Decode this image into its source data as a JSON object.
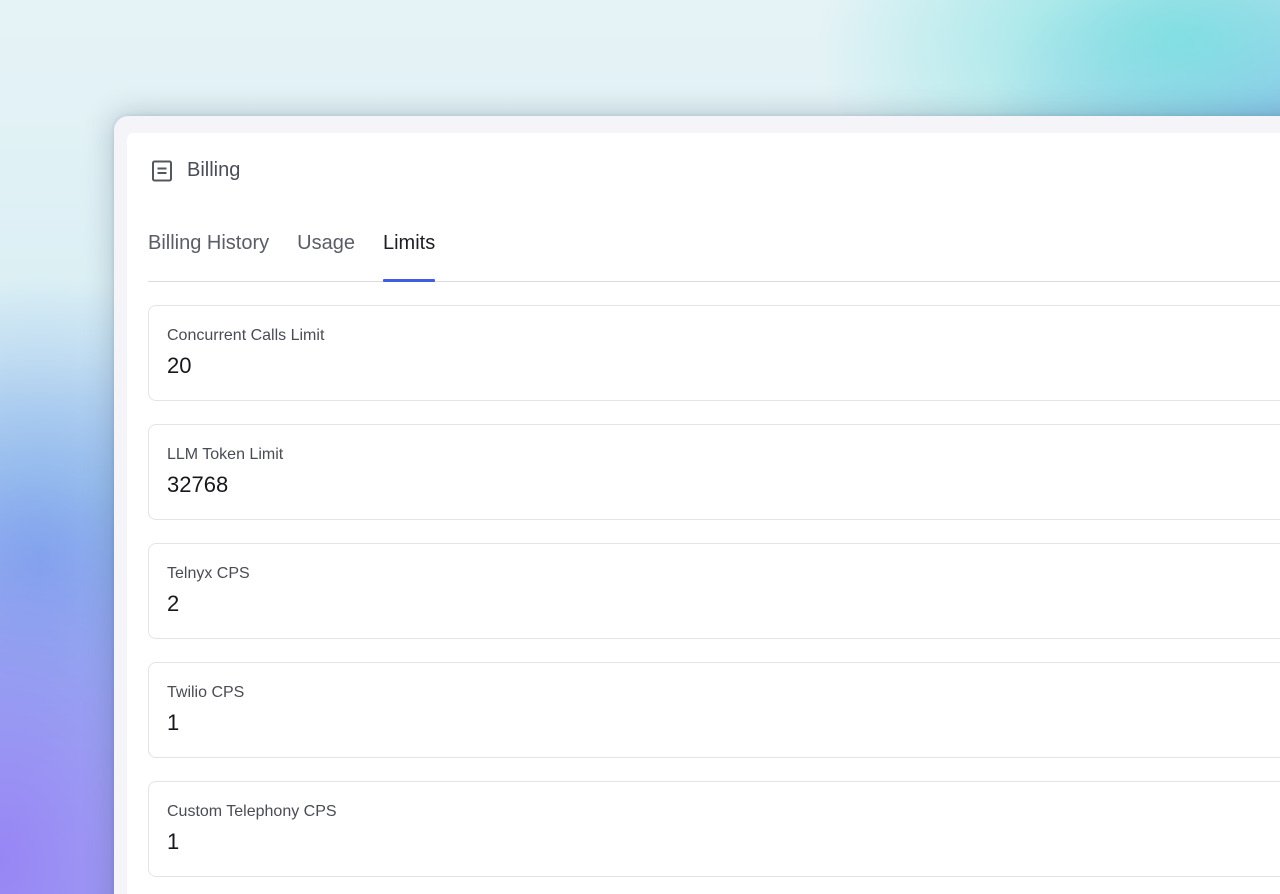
{
  "header": {
    "icon": "document-icon",
    "title": "Billing"
  },
  "tabs": [
    {
      "label": "Billing History",
      "active": false
    },
    {
      "label": "Usage",
      "active": false
    },
    {
      "label": "Limits",
      "active": true
    }
  ],
  "limits": [
    {
      "label": "Concurrent Calls Limit",
      "value": "20"
    },
    {
      "label": "LLM Token Limit",
      "value": "32768"
    },
    {
      "label": "Telnyx CPS",
      "value": "2"
    },
    {
      "label": "Twilio CPS",
      "value": "1"
    },
    {
      "label": "Custom Telephony CPS",
      "value": "1"
    }
  ],
  "colors": {
    "accent": "#3f5fe0",
    "text_primary": "#17181c",
    "text_secondary": "#4a4c55"
  }
}
